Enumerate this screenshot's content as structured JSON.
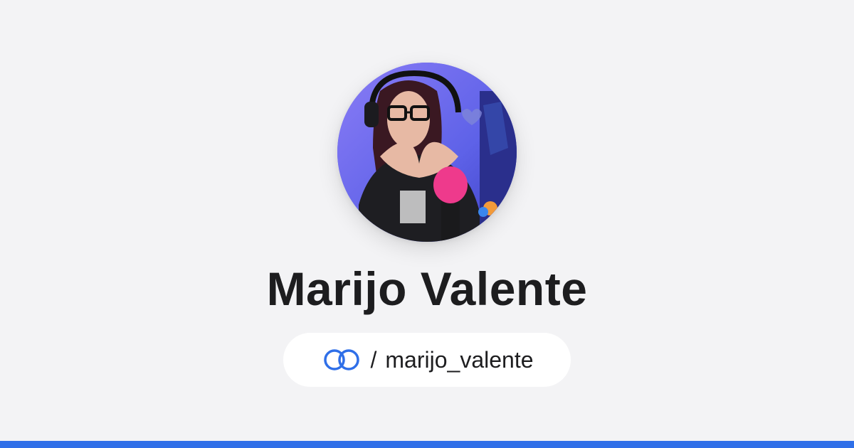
{
  "profile": {
    "name": "Marijo Valente",
    "separator": "/",
    "handle": "marijo_valente",
    "avatar_alt": "profile-photo"
  },
  "brand": {
    "logo_icon": "linked-rings-icon",
    "accent_color": "#2f6fe8"
  }
}
